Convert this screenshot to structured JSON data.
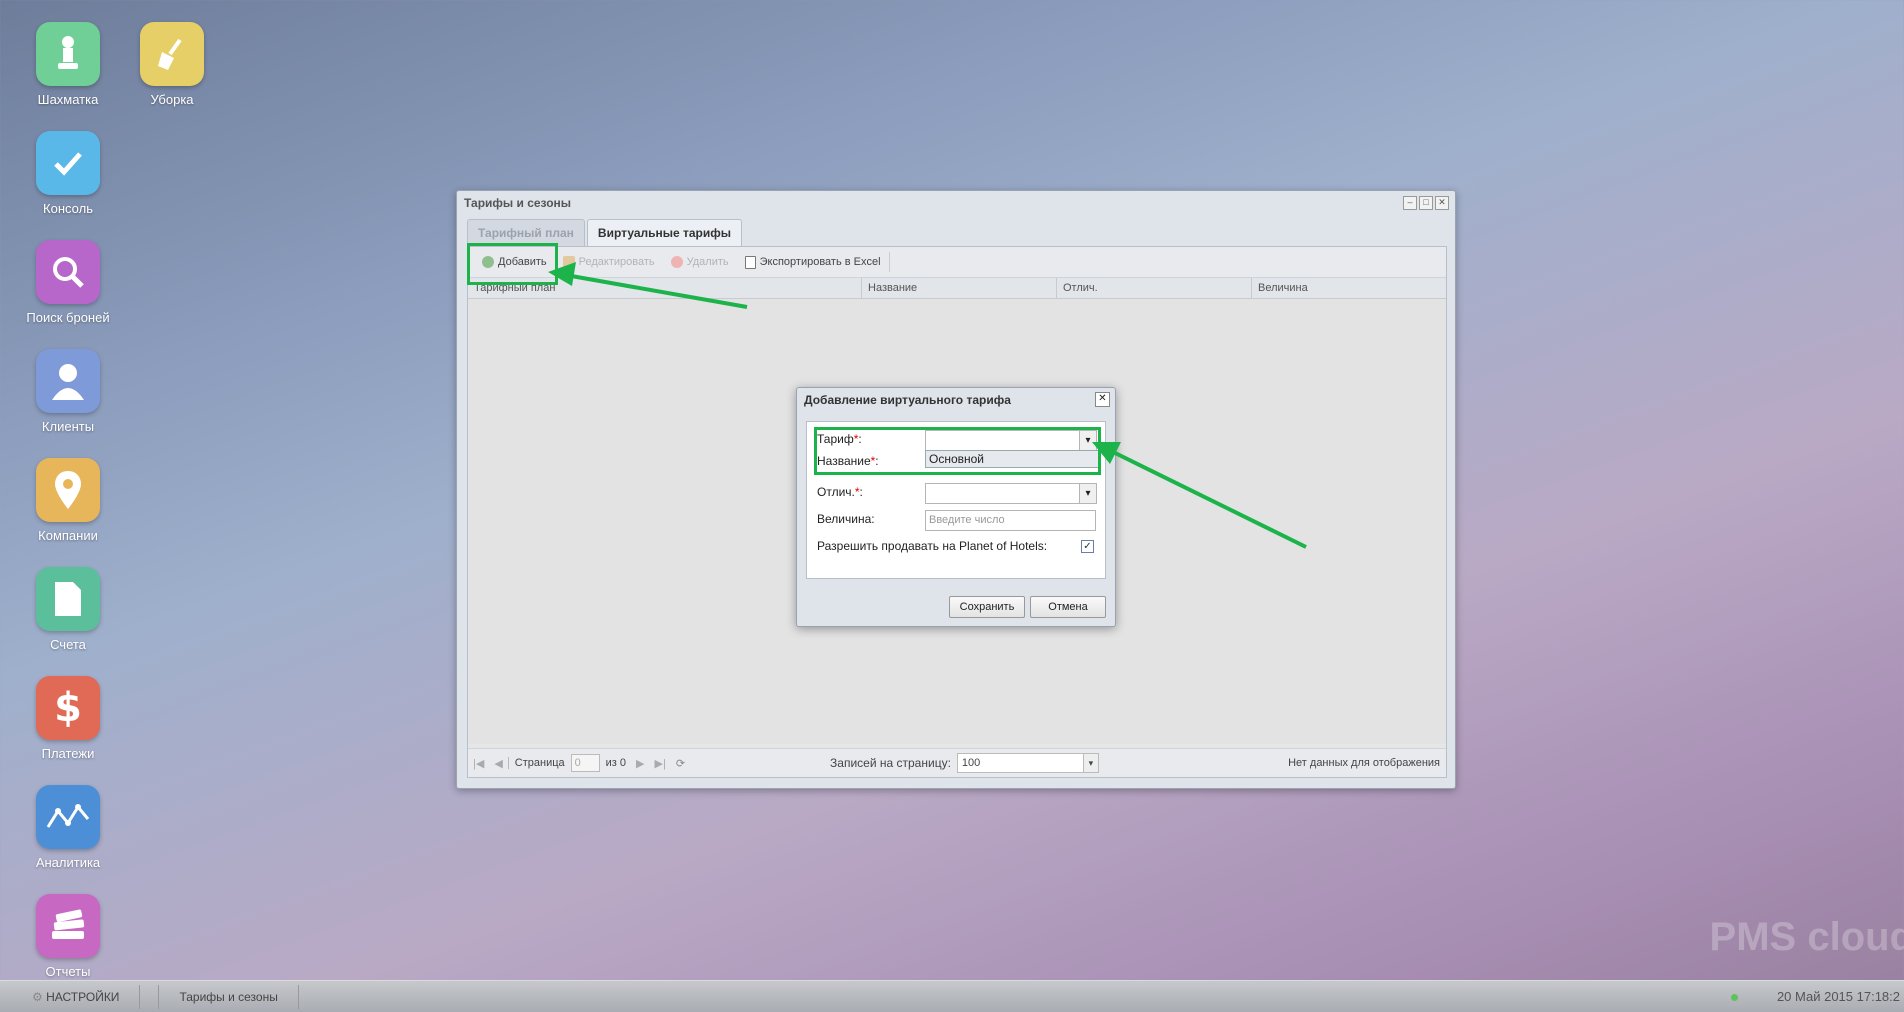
{
  "desktop": {
    "icons": [
      {
        "label": "Шахматка",
        "color": "#6fcf97"
      },
      {
        "label": "Уборка",
        "color": "#e6cf66"
      },
      {
        "label": "Консоль",
        "color": "#5ab8e8"
      },
      {
        "label": "Поиск броней",
        "color": "#b667c9"
      },
      {
        "label": "Клиенты",
        "color": "#7f9ad8"
      },
      {
        "label": "Компании",
        "color": "#e8b65a"
      },
      {
        "label": "Счета",
        "color": "#5bbf9c"
      },
      {
        "label": "Платежи",
        "color": "#e06a55"
      },
      {
        "label": "Аналитика",
        "color": "#4d8fd6"
      },
      {
        "label": "Отчеты",
        "color": "#c768c3"
      }
    ]
  },
  "window": {
    "title": "Тарифы и сезоны",
    "tabs": [
      {
        "label": "Тарифный план"
      },
      {
        "label": "Виртуальные тарифы"
      }
    ],
    "toolbar": {
      "add": "Добавить",
      "edit": "Редактировать",
      "delete": "Удалить",
      "export": "Экспортировать в Excel"
    },
    "columns": [
      "Тарифный план",
      "Название",
      "Отлич.",
      "Величина"
    ],
    "pager": {
      "page_label": "Страница",
      "page_value": "0",
      "of_label": "из 0",
      "per_page_label": "Записей на страницу:",
      "per_page_value": "100",
      "empty_text": "Нет данных для отображения"
    }
  },
  "dialog": {
    "title": "Добавление виртуального тарифа",
    "fields": {
      "tariff_label": "Тариф",
      "name_label": "Название",
      "diff_label": "Отлич.",
      "amount_label": "Величина:",
      "amount_placeholder": "Введите число",
      "allow_label": "Разрешить продавать на Planet of Hotels:",
      "allow_checked": true
    },
    "dropdown_option": "Основной",
    "save": "Сохранить",
    "cancel": "Отмена"
  },
  "taskbar": {
    "settings": "НАСТРОЙКИ",
    "task": "Тарифы и сезоны",
    "clock": "20 Май 2015 17:18:2"
  },
  "watermark": "PMS cloud",
  "colors": {
    "highlight": "#1db34b"
  }
}
